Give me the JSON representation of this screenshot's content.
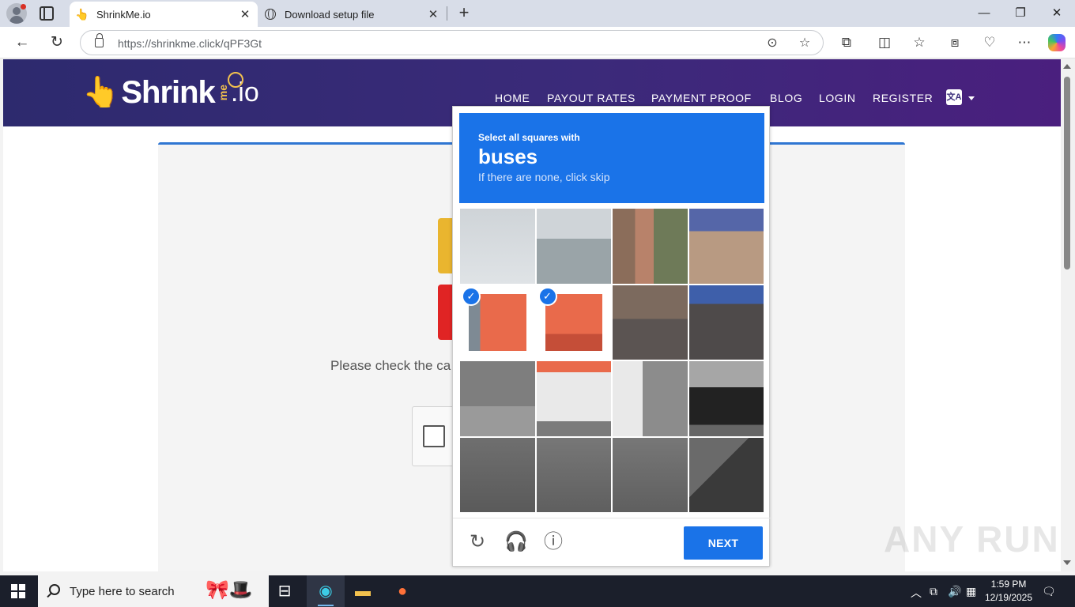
{
  "browser": {
    "tabs": [
      {
        "title": "ShrinkMe.io",
        "active": true
      },
      {
        "title": "Download setup file",
        "active": false
      }
    ],
    "url_host": "https://shrinkme.click/",
    "url_path": "qPF3Gt"
  },
  "site": {
    "logo_text": "Shrink",
    "logo_me": "me",
    "logo_tld": ".io",
    "nav": [
      "HOME",
      "PAYOUT RATES",
      "PAYMENT PROOF",
      "BLOG",
      "LOGIN",
      "REGISTER"
    ],
    "language_icon": "translate-icon",
    "message": "Please check the ca"
  },
  "captcha": {
    "instruction": "Select all squares with",
    "target": "buses",
    "hint": "If there are none, click skip",
    "selected_tiles": [
      4,
      5
    ],
    "next_label": "NEXT",
    "footer_icons": [
      "reload-icon",
      "audio-icon",
      "info-icon"
    ]
  },
  "watermark": "ANY RUN",
  "taskbar": {
    "search_placeholder": "Type here to search",
    "time": "1:59 PM",
    "date": "12/19/2025"
  },
  "colors": {
    "captcha_blue": "#1a73e8",
    "header_start": "#2d2a6e",
    "header_end": "#4a1f7e"
  }
}
